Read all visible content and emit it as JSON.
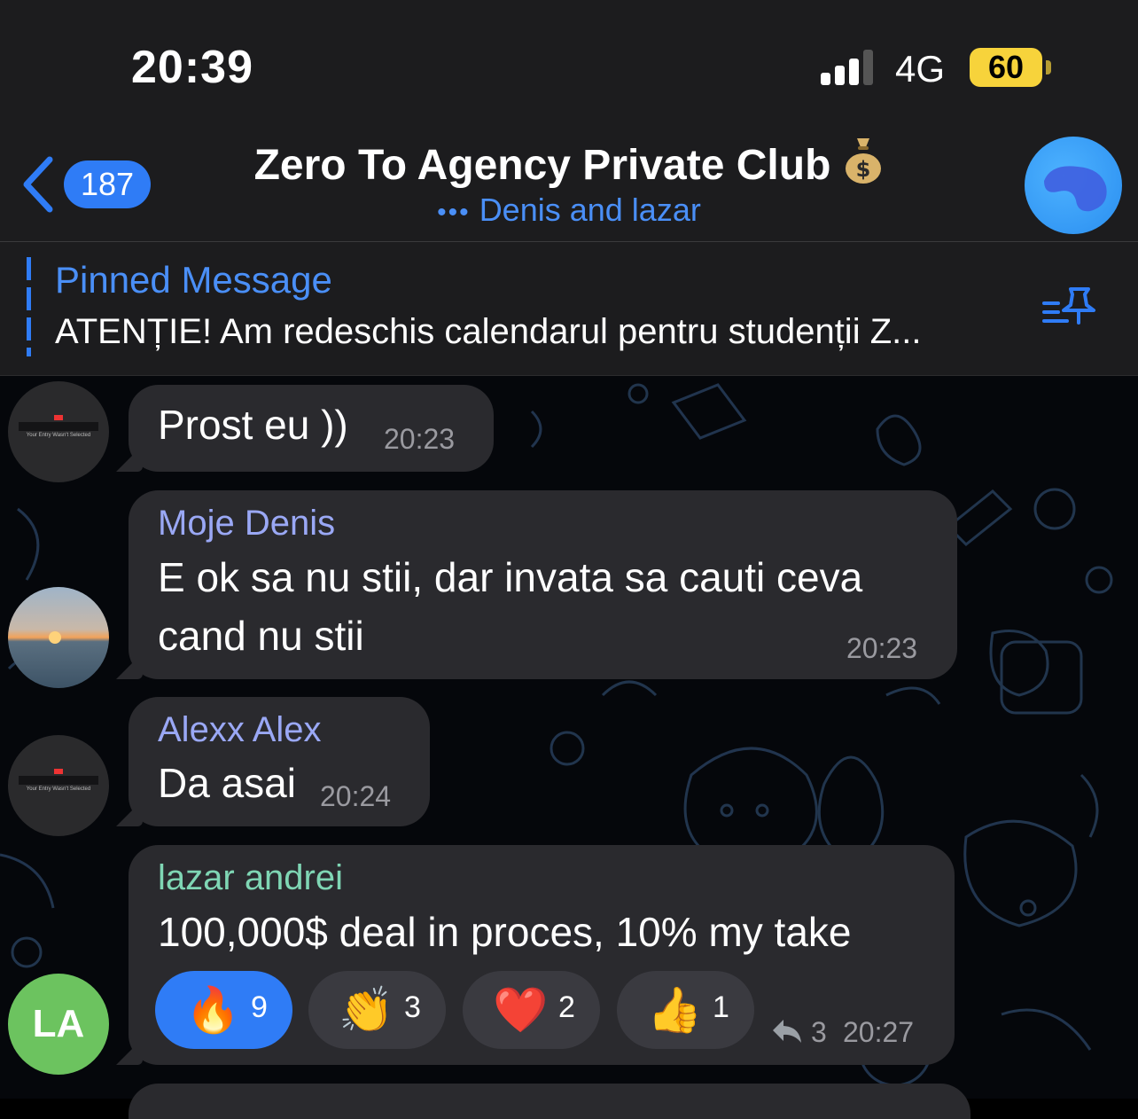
{
  "status_bar": {
    "time": "20:39",
    "network": "4G",
    "battery": "60"
  },
  "header": {
    "back_count": "187",
    "title": "Zero To Agency Private Club",
    "title_emoji_icon": "money-bag-icon",
    "typing_indicator": "•••",
    "subtitle": "Denis and lazar"
  },
  "pinned": {
    "title": "Pinned Message",
    "text": "ATENȚIE! Am redeschis calendarul pentru studenții Z..."
  },
  "avatars": {
    "mini_caption": "Your Entry Wasn't Selected",
    "la_initials": "LA"
  },
  "messages": [
    {
      "sender": "",
      "text": "Prost eu ))",
      "time": "20:23"
    },
    {
      "sender": "Moje Denis",
      "lines": [
        "E ok sa nu stii, dar invata sa cauti ceva",
        "cand nu stii"
      ],
      "time": "20:23",
      "sender_color": "#9aa8f5"
    },
    {
      "sender": "Alexx Alex",
      "text": "Da asai",
      "time": "20:24",
      "sender_color": "#9aa8f5"
    },
    {
      "sender": "lazar andrei",
      "text": "100,000$ deal in proces, 10% my take",
      "time": "20:27",
      "replies": "3",
      "sender_color": "#7fd6b4"
    }
  ],
  "reactions": [
    {
      "emoji": "🔥",
      "icon": "fire-icon",
      "count": "9",
      "active": true
    },
    {
      "emoji": "👏",
      "icon": "clapping-hands-icon",
      "count": "3",
      "active": false
    },
    {
      "emoji": "❤️",
      "icon": "heart-icon",
      "count": "2",
      "active": false
    },
    {
      "emoji": "👍",
      "icon": "thumbs-up-icon",
      "count": "1",
      "active": false
    }
  ],
  "colors": {
    "accent": "#2f7cf6",
    "bubble": "#2a2a2e",
    "battery": "#f7d33b",
    "la_avatar": "#6cc35f"
  }
}
